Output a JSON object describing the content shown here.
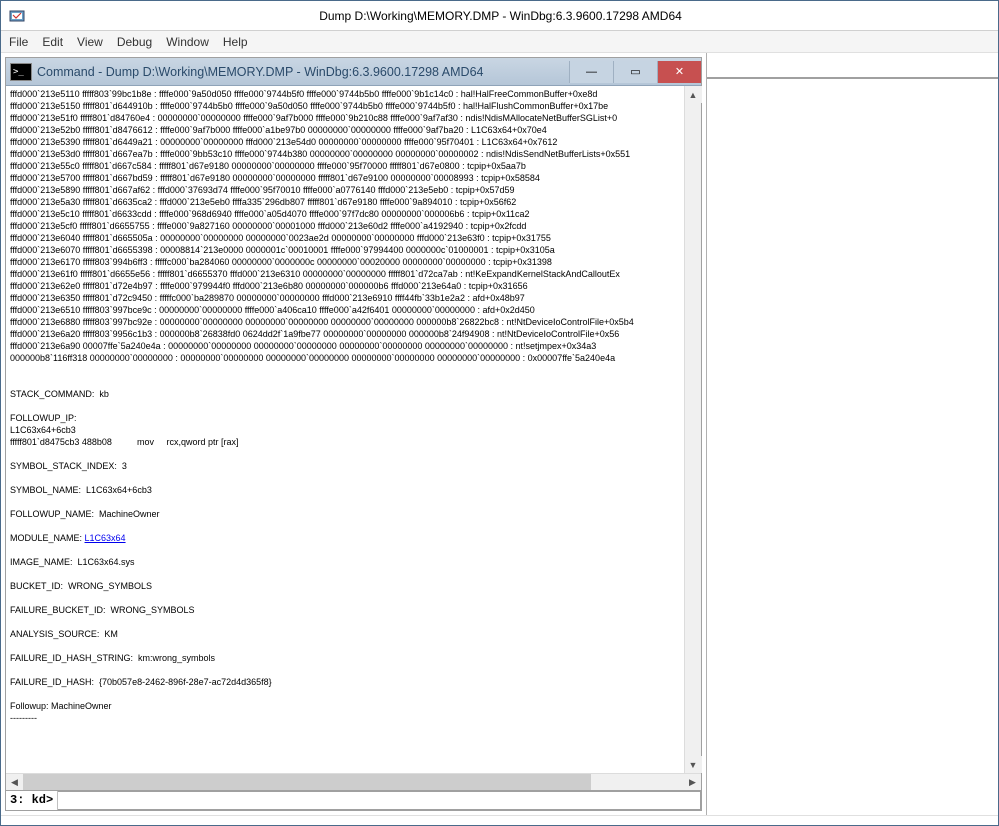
{
  "app": {
    "title": "Dump D:\\Working\\MEMORY.DMP - WinDbg:6.3.9600.17298 AMD64"
  },
  "menu": {
    "file": "File",
    "edit": "Edit",
    "view": "View",
    "debug": "Debug",
    "window": "Window",
    "help": "Help"
  },
  "cmd": {
    "title": "Command - Dump D:\\Working\\MEMORY.DMP - WinDbg:6.3.9600.17298 AMD64",
    "icon_text": ">_",
    "minimize": "—",
    "maximize": "▭",
    "close": "✕",
    "scroll_up": "▲",
    "scroll_down": "▼",
    "scroll_left": "◀",
    "scroll_right": "▶",
    "prompt": "3: kd>",
    "input_value": "",
    "module_link": "L1C63x64",
    "lines_pre": "fffd000`213e5110 fffff803`99bc1b8e : ffffe000`9a50d050 ffffe000`9744b5f0 ffffe000`9744b5b0 ffffe000`9b1c14c0 : hal!HalFreeCommonBuffer+0xe8d\nfffd000`213e5150 fffff801`d644910b : ffffe000`9744b5b0 ffffe000`9a50d050 ffffe000`9744b5b0 ffffe000`9744b5f0 : hal!HalFlushCommonBuffer+0x17be\nfffd000`213e51f0 fffff801`d84760e4 : 00000000`00000000 ffffe000`9af7b000 ffffe000`9b210c88 ffffe000`9af7af30 : ndis!NdisMAllocateNetBufferSGList+0\nfffd000`213e52b0 fffff801`d8476612 : ffffe000`9af7b000 ffffe000`a1be97b0 00000000`00000000 ffffe000`9af7ba20 : L1C63x64+0x70e4\nfffd000`213e5390 fffff801`d6449a21 : 00000000`00000000 fffd000`213e54d0 00000000`00000000 ffffe000`95f70401 : L1C63x64+0x7612\nfffd000`213e53d0 fffff801`d667ea7b : ffffe000`9bb53c10 ffffe000`9744b380 00000000`00000000 00000000`00000002 : ndis!NdisSendNetBufferLists+0x551\nfffd000`213e55c0 fffff801`d667c584 : fffff801`d67e9180 00000000`00000000 ffffe000`95f70000 fffff801`d67e0800 : tcpip+0x5aa7b\nfffd000`213e5700 fffff801`d667bd59 : fffff801`d67e9180 00000000`00000000 fffff801`d67e9100 00000000`00008993 : tcpip+0x58584\nfffd000`213e5890 fffff801`d667af62 : fffd000`37693d74 ffffe000`95f70010 ffffe000`a0776140 fffd000`213e5eb0 : tcpip+0x57d59\nfffd000`213e5a30 fffff801`d6635ca2 : fffd000`213e5eb0 ffffa335`296db807 fffff801`d67e9180 ffffe000`9a894010 : tcpip+0x56f62\nfffd000`213e5c10 fffff801`d6633cdd : ffffe000`968d6940 ffffe000`a05d4070 ffffe000`97f7dc80 00000000`000006b6 : tcpip+0x11ca2\nfffd000`213e5cf0 fffff801`d6655755 : ffffe000`9a827160 00000000`00001000 fffd000`213e60d2 ffffe000`a4192940 : tcpip+0x2fcdd\nfffd000`213e6040 fffff801`d665505a : 00000000`00000000 00000000`0023ae2d 00000000`00000000 fffd000`213e63f0 : tcpip+0x31755\nfffd000`213e6070 fffff801`d6655398 : 00008814`213e0000 0000001c`00010001 ffffe000`97994400 0000000c`01000001 : tcpip+0x3105a\nfffd000`213e6170 fffff803`994b6ff3 : fffffc000`ba284060 00000000`0000000c 00000000`00020000 00000000`00000000 : tcpip+0x31398\nfffd000`213e61f0 fffff801`d6655e56 : fffff801`d6655370 fffd000`213e6310 00000000`00000000 fffff801`d72ca7ab : nt!KeExpandKernelStackAndCalloutEx\nfffd000`213e62e0 fffff801`d72e4b97 : ffffe000`979944f0 fffd000`213e6b80 00000000`000000b6 fffd000`213e64a0 : tcpip+0x31656\nfffd000`213e6350 fffff801`d72c9450 : fffffc000`ba289870 00000000`00000000 fffd000`213e6910 ffff44fb`33b1e2a2 : afd+0x48b97\nfffd000`213e6510 fffff803`997bce9c : 00000000`00000000 ffffe000`a406ca10 ffffe000`a42f6401 00000000`00000000 : afd+0x2d450\nfffd000`213e6880 fffff803`997bc92e : 00000000`00000000 00000000`00000000 00000000`00000000 000000b8`26822bc8 : nt!NtDeviceIoControlFile+0x5b4\nfffd000`213e6a20 fffff803`9956c1b3 : 000000b8`26838fd0 0624dd2f`1a9fbe77 00000000`00000000 000000b8`24f94908 : nt!NtDeviceIoControlFile+0x56\nfffd000`213e6a90 00007ffe`5a240e4a : 00000000`00000000 00000000`00000000 00000000`00000000 00000000`00000000 : nt!setjmpex+0x34a3\n000000b8`116ff318 00000000`00000000 : 00000000`00000000 00000000`00000000 00000000`00000000 00000000`00000000 : 0x00007ffe`5a240e4a\n\n\nSTACK_COMMAND:  kb\n\nFOLLOWUP_IP: \nL1C63x64+6cb3\nfffff801`d8475cb3 488b08          mov     rcx,qword ptr [rax]\n\nSYMBOL_STACK_INDEX:  3\n\nSYMBOL_NAME:  L1C63x64+6cb3\n\nFOLLOWUP_NAME:  MachineOwner\n\nMODULE_NAME: ",
    "lines_post": "\n\nIMAGE_NAME:  L1C63x64.sys\n\nBUCKET_ID:  WRONG_SYMBOLS\n\nFAILURE_BUCKET_ID:  WRONG_SYMBOLS\n\nANALYSIS_SOURCE:  KM\n\nFAILURE_ID_HASH_STRING:  km:wrong_symbols\n\nFAILURE_ID_HASH:  {70b057e8-2462-896f-28e7-ac72d4d365f8}\n\nFollowup: MachineOwner\n---------\n\n"
  }
}
